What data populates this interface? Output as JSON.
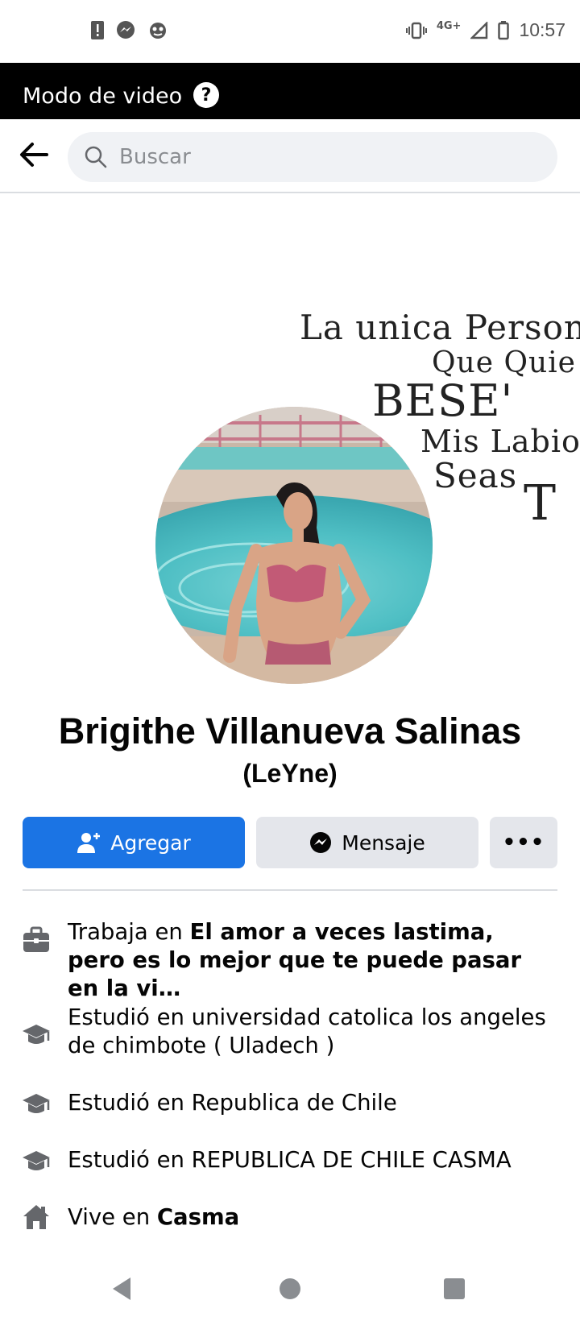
{
  "status_bar": {
    "time": "10:57",
    "network": "4G+",
    "left_icons": [
      "alert-icon",
      "messenger-notification-icon",
      "app-notification-icon"
    ],
    "right_icons": [
      "vibrate-icon",
      "signal-icon",
      "battery-icon"
    ]
  },
  "video_mode": {
    "label": "Modo de video",
    "help_icon": "help-icon"
  },
  "search": {
    "placeholder": "Buscar"
  },
  "cover": {
    "lines": [
      "La unica Person",
      "Que Quie",
      "BESE'",
      "Mis Labios",
      "Seas",
      "T"
    ]
  },
  "profile": {
    "name": "Brigithe Villanueva Salinas",
    "alternate_name": "(LeYne)"
  },
  "actions": {
    "add_label": "Agregar",
    "message_label": "Mensaje",
    "more_label": "•••"
  },
  "info": [
    {
      "icon": "briefcase-icon",
      "prefix": "Trabaja en ",
      "bold": "El amor a veces lastima, pero es lo mejor que te puede pasar en la vi…"
    },
    {
      "icon": "graduation-cap-icon",
      "prefix": "Estudió en universidad catolica los angeles de chimbote ( Uladech )",
      "bold": ""
    },
    {
      "icon": "graduation-cap-icon",
      "prefix": "Estudió en Republica de Chile",
      "bold": ""
    },
    {
      "icon": "graduation-cap-icon",
      "prefix": "Estudió en REPUBLICA DE CHILE CASMA",
      "bold": ""
    },
    {
      "icon": "home-icon",
      "prefix": "Vive en ",
      "bold": "Casma"
    }
  ],
  "colors": {
    "primary": "#1b74e4",
    "secondary_button": "#e4e6eb",
    "search_bg": "#f0f2f5",
    "icon_gray": "#65676b"
  }
}
